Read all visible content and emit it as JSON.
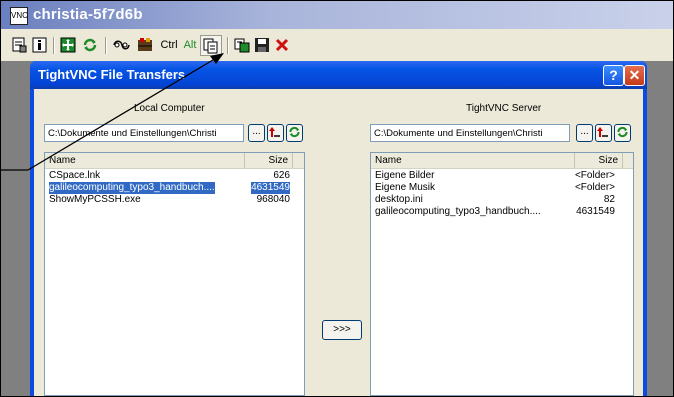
{
  "window": {
    "title": "christia-5f7d6b",
    "icon_name": "vnc-app-icon"
  },
  "toolbar": {
    "buttons": [
      {
        "name": "options-icon"
      },
      {
        "name": "info-icon"
      },
      {
        "name": "fullscreen-icon"
      },
      {
        "name": "refresh-icon"
      },
      {
        "name": "keyboard-icon"
      },
      {
        "name": "ctrl-alt-del-icon"
      },
      {
        "label": "Ctrl"
      },
      {
        "label": "Alt"
      },
      {
        "name": "copy-icon"
      },
      {
        "name": "file-transfer-icon"
      },
      {
        "name": "save-icon"
      },
      {
        "name": "disconnect-icon"
      }
    ],
    "ctrl_label": "Ctrl",
    "alt_label": "Alt"
  },
  "dialog": {
    "title": "TightVNC File Transfers",
    "help_label": "?",
    "close_label": "✕",
    "local": {
      "heading": "Local Computer",
      "path": "C:\\Dokumente und Einstellungen\\Christi",
      "browse_label": "...",
      "col_name": "Name",
      "col_size": "Size",
      "files": [
        {
          "name": "CSpace.lnk",
          "size": "626",
          "selected": false
        },
        {
          "name": "galileocomputing_typo3_handbuch....",
          "size": "4631549",
          "selected": true
        },
        {
          "name": "ShowMyPCSSH.exe",
          "size": "968040",
          "selected": false
        }
      ]
    },
    "remote": {
      "heading": "TightVNC Server",
      "path": "C:\\Dokumente und Einstellungen\\Christi",
      "browse_label": "...",
      "col_name": "Name",
      "col_size": "Size",
      "files": [
        {
          "name": "Eigene Bilder",
          "size": "<Folder>"
        },
        {
          "name": "Eigene Musik",
          "size": "<Folder>"
        },
        {
          "name": "desktop.ini",
          "size": "82"
        },
        {
          "name": "galileocomputing_typo3_handbuch....",
          "size": "4631549"
        }
      ]
    },
    "transfer_label": ">>>"
  },
  "colors": {
    "title_gradient_start": "#6a7fbf",
    "dialog_blue": "#0a4be0",
    "selection": "#316ac5",
    "close_red": "#c43a16"
  }
}
